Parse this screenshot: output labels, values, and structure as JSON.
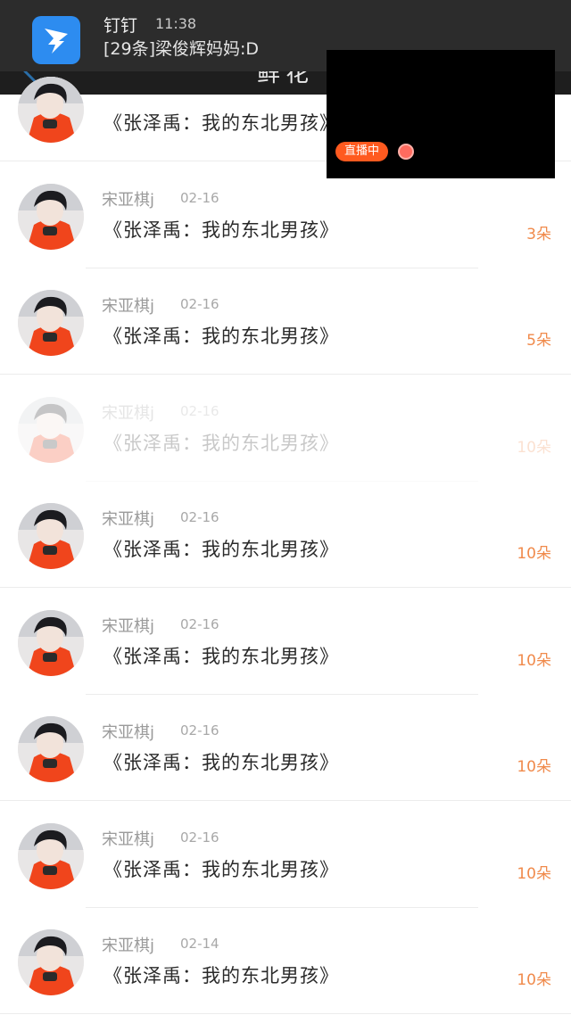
{
  "notification": {
    "app": "钉钉",
    "time": "11:38",
    "message": "[29条]梁俊辉妈妈:D",
    "icon": "dingtalk-icon"
  },
  "header": {
    "title": "鲜花",
    "back_icon": "chevron-left-icon",
    "close_icon": "close-icon"
  },
  "live": {
    "badge": "直播中"
  },
  "list": [
    {
      "name": "",
      "date": "",
      "text": "《张泽禹：我的东北男孩》",
      "count": ""
    },
    {
      "name": "宋亚棋j",
      "date": "02-16",
      "text": "《张泽禹：我的东北男孩》",
      "count": "3朵"
    },
    {
      "name": "宋亚棋j",
      "date": "02-16",
      "text": "《张泽禹：我的东北男孩》",
      "count": "5朵"
    },
    {
      "name": "宋亚棋j",
      "date": "02-16",
      "text": "《张泽禹：我的东北男孩》",
      "count": "10朵"
    },
    {
      "name": "宋亚棋j",
      "date": "02-16",
      "text": "《张泽禹：我的东北男孩》",
      "count": "10朵"
    },
    {
      "name": "宋亚棋j",
      "date": "02-16",
      "text": "《张泽禹：我的东北男孩》",
      "count": "10朵"
    },
    {
      "name": "宋亚棋j",
      "date": "02-16",
      "text": "《张泽禹：我的东北男孩》",
      "count": "10朵"
    },
    {
      "name": "宋亚棋j",
      "date": "02-16",
      "text": "《张泽禹：我的东北男孩》",
      "count": "10朵"
    },
    {
      "name": "宋亚棋j",
      "date": "02-14",
      "text": "《张泽禹：我的东北男孩》",
      "count": "10朵"
    }
  ],
  "colors": {
    "accent": "#f08a4b",
    "live_badge": "#ff5a1f",
    "header": "#1e1e1e"
  }
}
